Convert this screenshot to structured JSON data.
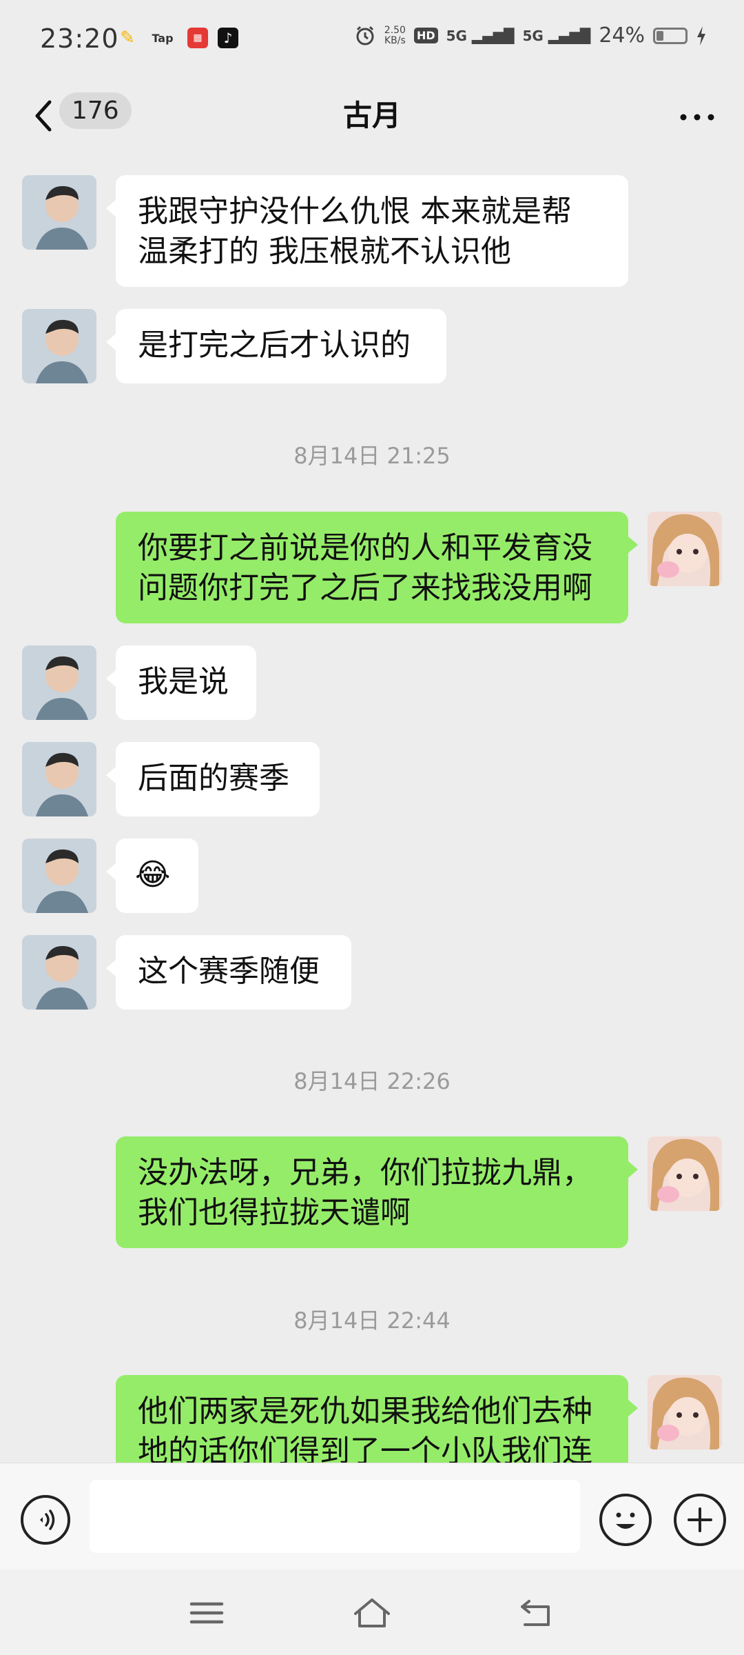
{
  "status_bar": {
    "time": "23:20",
    "app_tap": "Tap",
    "net_speed_value": "2.50",
    "net_speed_unit": "KB/s",
    "hd_label": "HD",
    "signal_1": "5G",
    "signal_2": "5G",
    "battery": "24%",
    "battery_level": 0.24
  },
  "header": {
    "unread_count": "176",
    "title": "古月"
  },
  "messages": [
    {
      "type": "msg",
      "side": "left",
      "lines": [
        "我跟守护没什么仇恨 本来就是帮",
        "温柔打的 我压根就不认识他"
      ]
    },
    {
      "type": "msg",
      "side": "left",
      "lines": [
        "是打完之后才认识的"
      ]
    },
    {
      "type": "time",
      "text": "8月14日 21:25"
    },
    {
      "type": "msg",
      "side": "right",
      "lines": [
        "你要打之前说是你的人和平发育没",
        "问题你打完了之后了来找我没用啊"
      ]
    },
    {
      "type": "msg",
      "side": "left",
      "lines": [
        "我是说"
      ]
    },
    {
      "type": "msg",
      "side": "left",
      "lines": [
        "后面的赛季"
      ]
    },
    {
      "type": "msg",
      "side": "left",
      "lines": [
        "😂"
      ]
    },
    {
      "type": "msg",
      "side": "left",
      "lines": [
        "这个赛季随便"
      ]
    },
    {
      "type": "time",
      "text": "8月14日 22:26"
    },
    {
      "type": "msg",
      "side": "right",
      "lines": [
        "没办法呀，兄弟，你们拉拢九鼎，",
        "我们也得拉拢天谴啊"
      ]
    },
    {
      "type": "time",
      "text": "8月14日 22:44"
    },
    {
      "type": "msg",
      "side": "right",
      "lines": [
        "他们两家是死仇如果我给他们去种",
        "地的话你们得到了一个小队我们连"
      ]
    }
  ],
  "input": {
    "value": ""
  },
  "icons": {
    "back": "chevron-left-icon",
    "more": "more-dots-icon",
    "voice": "voice-icon",
    "emoji": "emoji-icon",
    "plus": "plus-icon",
    "nav_menu": "menu-icon",
    "nav_home": "home-icon",
    "nav_back": "back-arrow-icon"
  },
  "colors": {
    "chat_bg": "#EDEDED",
    "own_bubble": "#95EC69",
    "other_bubble": "#FFFFFF",
    "timestamp": "#9A9A9A"
  }
}
